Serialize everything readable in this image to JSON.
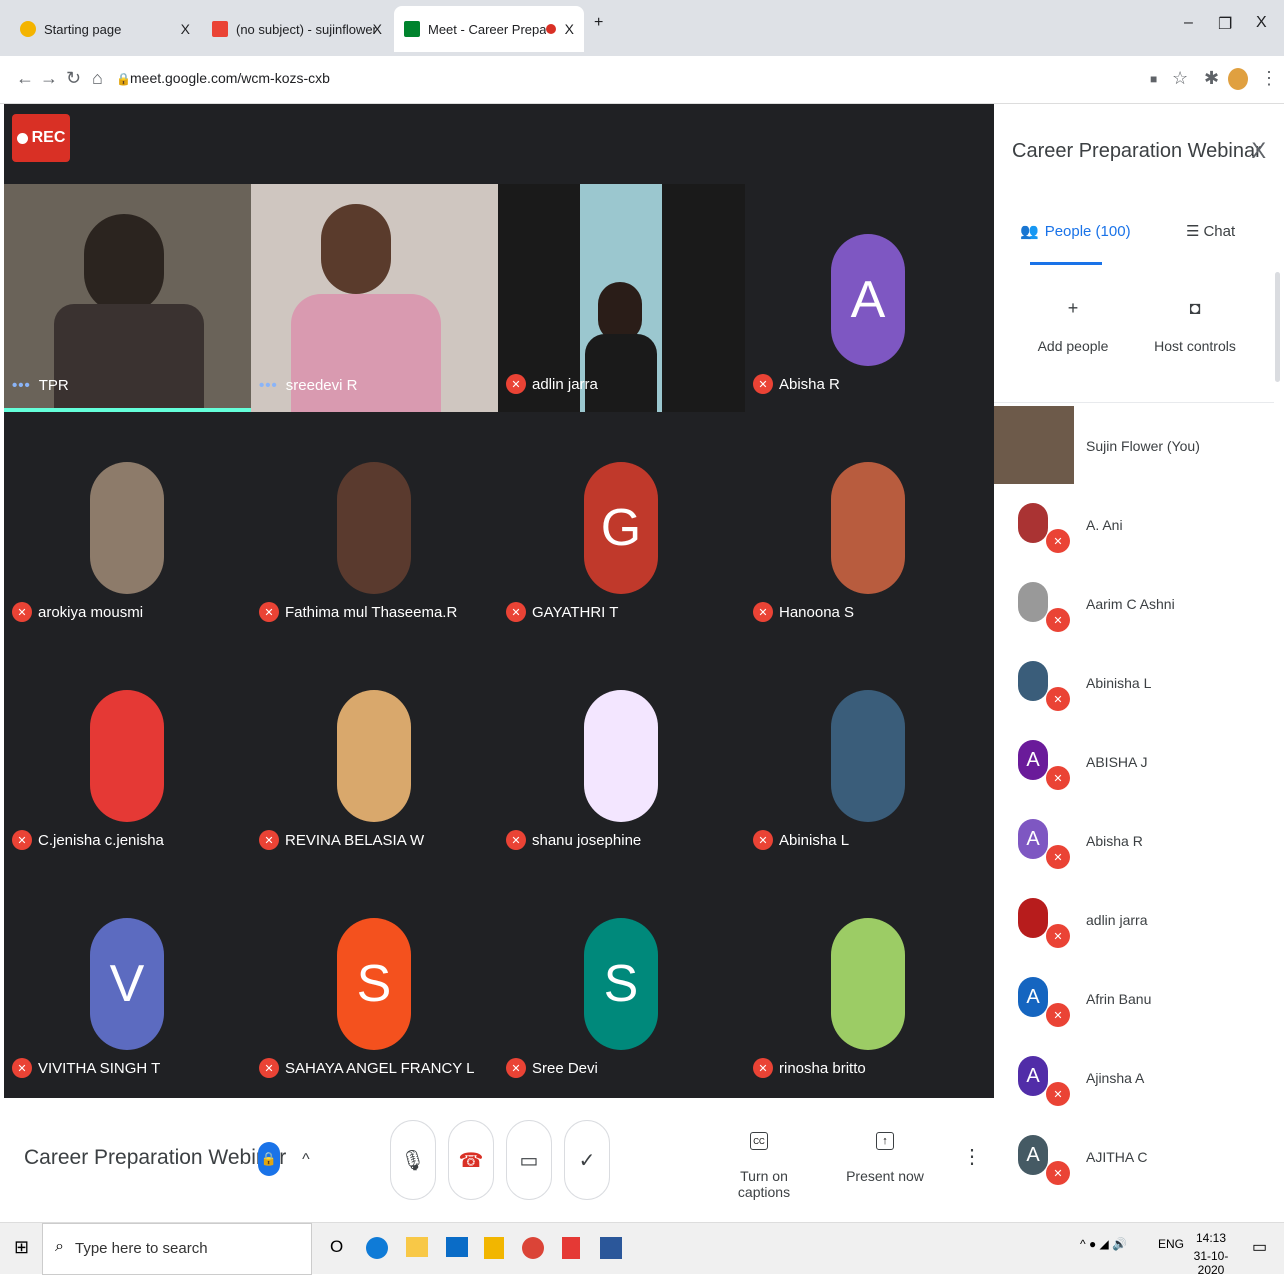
{
  "browser": {
    "tabs": [
      {
        "label": "Starting page",
        "close": "X"
      },
      {
        "label": "(no subject) - sujinflower@holycr",
        "close": "X"
      },
      {
        "label": "Meet - Career Preparation W",
        "close": "X"
      }
    ],
    "new_tab": "+",
    "url": "meet.google.com/wcm-kozs-cxb",
    "window_controls": {
      "minimize": "–",
      "restore": "❐",
      "close": "X"
    }
  },
  "meet": {
    "rec_label": "REC",
    "tiles_top": [
      {
        "name": "TPR",
        "state": "speaking"
      },
      {
        "name": "sreedevi R",
        "state": "speaking"
      },
      {
        "name": "adlin jarra",
        "state": "muted"
      },
      {
        "name": "Abisha R",
        "state": "muted",
        "letter": "A",
        "color": "#7e57c2"
      }
    ],
    "tiles": [
      {
        "name": "arokiya mousmi",
        "color": "#8d7b6a"
      },
      {
        "name": "Fathima mul Thaseema.R",
        "color": "#5a3a2e"
      },
      {
        "name": "GAYATHRI T",
        "letter": "G",
        "color": "#c0392b"
      },
      {
        "name": "Hanoona S",
        "color": "#b85c3e"
      },
      {
        "name": "C.jenisha c.jenisha",
        "color": "#e53935"
      },
      {
        "name": "REVINA BELASIA W",
        "color": "#d9a86c"
      },
      {
        "name": "shanu josephine",
        "color": "#f3e6ff"
      },
      {
        "name": "Abinisha L",
        "color": "#3a5d7a"
      },
      {
        "name": "VIVITHA SINGH T",
        "letter": "V",
        "color": "#5c6bc0"
      },
      {
        "name": "SAHAYA ANGEL FRANCY L",
        "letter": "S",
        "color": "#f4511e"
      },
      {
        "name": "Sree Devi",
        "letter": "S",
        "color": "#00897b"
      },
      {
        "name": "rinosha britto",
        "color": "#9ccc65"
      }
    ]
  },
  "panel": {
    "title": "Career Preparation Webinar",
    "close": "X",
    "people_tab": "People (100)",
    "chat_tab": "Chat",
    "add_people": "Add people",
    "host_controls": "Host controls",
    "people": [
      {
        "name": "Sujin Flower (You)",
        "color": "#6d5a4a"
      },
      {
        "name": "A. Ani",
        "color": "#a33"
      },
      {
        "name": "Aarim C Ashni",
        "color": "#999"
      },
      {
        "name": "Abinisha L",
        "color": "#3a5d7a"
      },
      {
        "name": "ABISHA J",
        "letter": "A",
        "color": "#6a1b9a"
      },
      {
        "name": "Abisha R",
        "letter": "A",
        "color": "#7e57c2"
      },
      {
        "name": "adlin jarra",
        "color": "#b71c1c"
      },
      {
        "name": "Afrin Banu",
        "letter": "A",
        "color": "#1565c0"
      },
      {
        "name": "Ajinsha A",
        "letter": "A",
        "color": "#512da8"
      },
      {
        "name": "AJITHA C",
        "letter": "A",
        "color": "#455a64"
      }
    ]
  },
  "bottom": {
    "meeting_title": "Career Preparation Webinar",
    "chevron": "^",
    "captions": "Turn on captions",
    "present": "Present now"
  },
  "taskbar": {
    "search_placeholder": "Type here to search",
    "cortana": "O",
    "lang": "ENG",
    "time": "14:13",
    "date": "31-10-2020"
  }
}
